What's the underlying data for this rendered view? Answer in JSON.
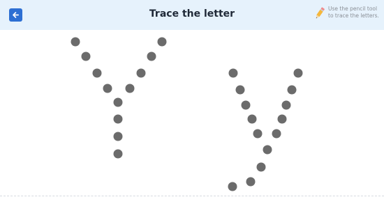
{
  "header": {
    "title": "Trace the letter",
    "hint_line1": "Use the pencil tool",
    "hint_line2": "to trace the letters.",
    "back_icon": "arrow-left-icon",
    "pencil_icon": "pencil-icon"
  },
  "colors": {
    "header_bg": "#e6f2fc",
    "accent": "#2d6fd3",
    "dot": "#6b6b6b"
  }
}
